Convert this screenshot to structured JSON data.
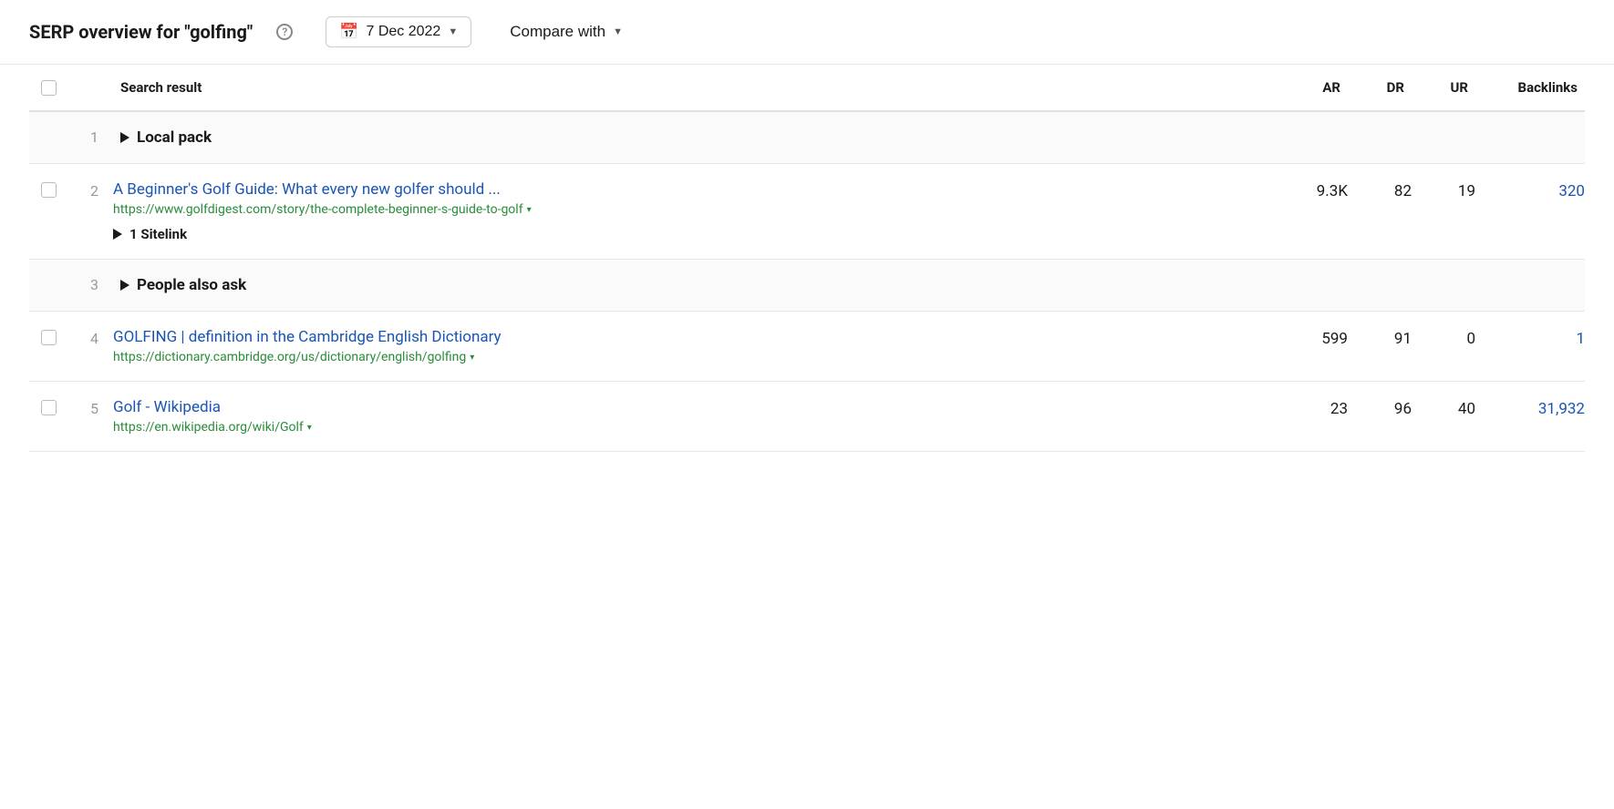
{
  "header": {
    "title": "SERP overview for \"golfing\"",
    "help_label": "?",
    "date": "7 Dec 2022",
    "compare_label": "Compare with"
  },
  "table": {
    "columns": {
      "checkbox": "",
      "num": "",
      "result": "Search result",
      "ar": "AR",
      "dr": "DR",
      "ur": "UR",
      "backlinks": "Backlinks"
    },
    "rows": [
      {
        "type": "special-no-checkbox",
        "num": "1",
        "label": "Local pack",
        "ar": "",
        "dr": "",
        "ur": "",
        "backlinks": ""
      },
      {
        "type": "normal",
        "num": "2",
        "title": "A Beginner's Golf Guide: What every new golfer should ...",
        "url": "https://www.golfdigest.com/story/the-complete-beginner-s-guide-to-golf",
        "sitelink": "1 Sitelink",
        "ar": "9.3K",
        "dr": "82",
        "ur": "19",
        "backlinks": "320",
        "backlinks_blue": true
      },
      {
        "type": "special-no-checkbox",
        "num": "3",
        "label": "People also ask",
        "ar": "",
        "dr": "",
        "ur": "",
        "backlinks": ""
      },
      {
        "type": "normal",
        "num": "4",
        "title": "GOLFING | definition in the Cambridge English Dictionary",
        "url": "https://dictionary.cambridge.org/us/dictionary/english/golfing",
        "sitelink": null,
        "ar": "599",
        "dr": "91",
        "ur": "0",
        "backlinks": "1",
        "backlinks_blue": true
      },
      {
        "type": "normal",
        "num": "5",
        "title": "Golf - Wikipedia",
        "url": "https://en.wikipedia.org/wiki/Golf",
        "sitelink": null,
        "ar": "23",
        "dr": "96",
        "ur": "40",
        "backlinks": "31,932",
        "backlinks_blue": true
      }
    ]
  }
}
